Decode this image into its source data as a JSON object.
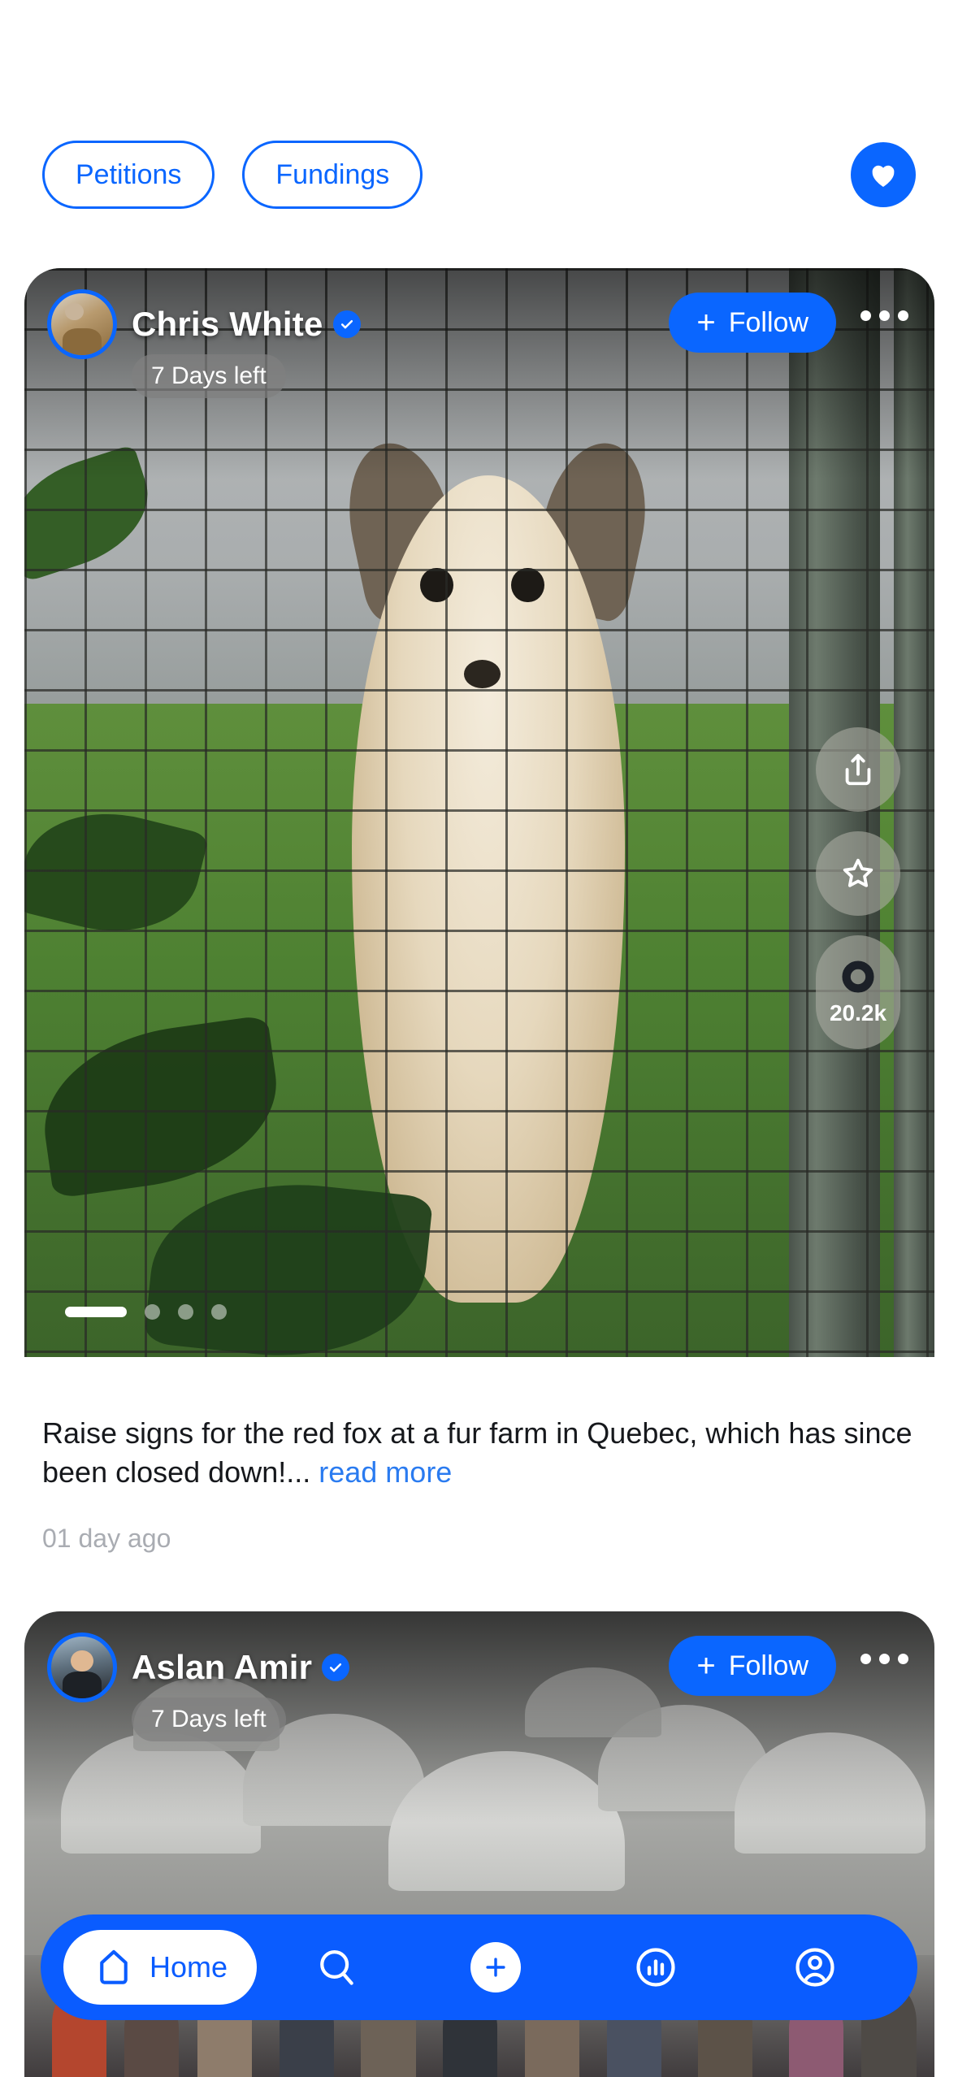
{
  "topbar": {
    "chips": [
      {
        "label": "Petitions",
        "name": "petitions"
      },
      {
        "label": "Fundings",
        "name": "fundings"
      }
    ],
    "favorites_icon": "heart-icon",
    "accent_color": "#0a66ff"
  },
  "feed": [
    {
      "author": "Chris White",
      "verified": true,
      "badge": "7 Days left",
      "follow_label": "Follow",
      "follow_plus": "+",
      "more_icon": "ellipsis-icon",
      "actions": {
        "share_icon": "share-icon",
        "star_icon": "star-icon",
        "sign_icon": "signature-ring-icon",
        "sign_count": "20.2k"
      },
      "pager": {
        "total": 4,
        "active": 1
      },
      "caption": "Raise signs for the red fox at a fur farm in Quebec, which has since been closed down!...",
      "read_more": "read more",
      "time_ago": "01 day ago",
      "image_alt": "white fox behind wire cage fence"
    },
    {
      "author": "Aslan Amir",
      "verified": true,
      "badge": "7 Days left",
      "follow_label": "Follow",
      "follow_plus": "+",
      "more_icon": "ellipsis-icon",
      "image_alt": "refugee camp with white tents and crowd"
    }
  ],
  "bottom_nav": {
    "background_color": "#0a5cff",
    "items": [
      {
        "name": "home",
        "label": "Home",
        "icon": "home-icon",
        "active": true
      },
      {
        "name": "search",
        "label": "",
        "icon": "search-icon",
        "active": false
      },
      {
        "name": "create",
        "label": "",
        "icon": "plus-icon",
        "active": false
      },
      {
        "name": "stats",
        "label": "",
        "icon": "bar-chart-icon",
        "active": false
      },
      {
        "name": "profile",
        "label": "",
        "icon": "user-icon",
        "active": false
      }
    ]
  }
}
